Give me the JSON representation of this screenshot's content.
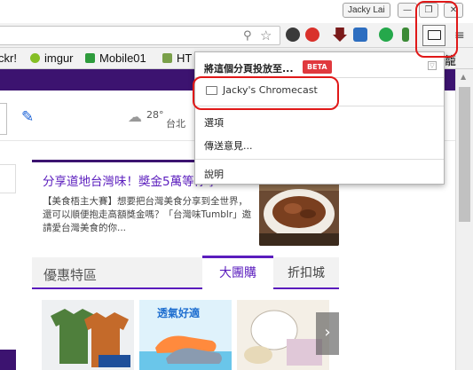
{
  "titlebar": {
    "user_name": "Jacky Lai",
    "minimize": "—",
    "restore": "❐",
    "close": "✕"
  },
  "toolbar": {
    "omnibox_value": ""
  },
  "bookmarks": [
    {
      "label": "ckr!",
      "color": ""
    },
    {
      "label": "imgur",
      "color": "#85bf25"
    },
    {
      "label": "Mobile01",
      "color": "#2e9b3c"
    },
    {
      "label": "HT",
      "color": "#7aa04a"
    }
  ],
  "bookmarks_overflow": "籠",
  "page": {
    "temperature": "28°",
    "city": "台北",
    "promo_title": "分享道地台灣味！獎金5萬等你拿",
    "promo_desc": "【美食梧主大賽】想要把台灣美食分享到全世界，還可以順便抱走高額獎金嗎？「台灣味Tumblr」邀請愛台灣美食的你...",
    "deals_title": "優惠特區",
    "tabs": [
      "大團購",
      "折扣城"
    ],
    "next_arrow": "›",
    "product_texts": [
      "",
      "透氣好適",
      "",
      ""
    ]
  },
  "cast_menu": {
    "title": "將這個分頁投放至...",
    "badge": "BETA",
    "device": "Jacky's Chromecast",
    "items": [
      "選項",
      "傳送意見...",
      "說明"
    ]
  },
  "colors": {
    "purple": "#3c1370",
    "accent": "#5a1cbd",
    "highlight": "#e01818",
    "beta": "#e0393e"
  }
}
